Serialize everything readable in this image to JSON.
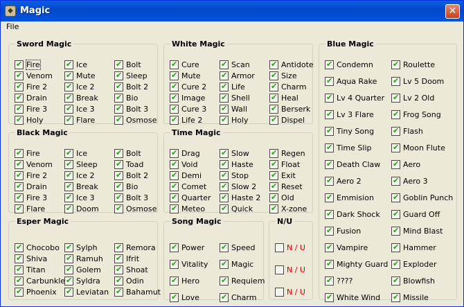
{
  "window": {
    "title": "Magic",
    "icon": "magic-app-icon",
    "close_label": "✕"
  },
  "menu": {
    "file": "File"
  },
  "groups": {
    "sword": {
      "title": "Sword Magic",
      "rows": [
        [
          "Fire",
          "Ice",
          "Bolt"
        ],
        [
          "Venom",
          "Mute",
          "Sleep"
        ],
        [
          "Fire 2",
          "Ice 2",
          "Bolt 2"
        ],
        [
          "Drain",
          "Break",
          "Bio"
        ],
        [
          "Fire 3",
          "Ice 3",
          "Bolt 3"
        ],
        [
          "Holy",
          "Flare",
          "Osmose"
        ]
      ]
    },
    "white": {
      "title": "White Magic",
      "rows": [
        [
          "Cure",
          "Scan",
          "Antidote"
        ],
        [
          "Mute",
          "Armor",
          "Size"
        ],
        [
          "Cure 2",
          "Life",
          "Charm"
        ],
        [
          "Image",
          "Shell",
          "Heal"
        ],
        [
          "Cure 3",
          "Wall",
          "Berserk"
        ],
        [
          "Life 2",
          "Holy",
          "Dispel"
        ]
      ]
    },
    "black": {
      "title": "Black Magic",
      "rows": [
        [
          "Fire",
          "Ice",
          "Bolt"
        ],
        [
          "Venom",
          "Sleep",
          "Toad"
        ],
        [
          "Fire 2",
          "Ice 2",
          "Bolt 2"
        ],
        [
          "Drain",
          "Break",
          "Bio"
        ],
        [
          "Fire 3",
          "Ice 3",
          "Bolt 3"
        ],
        [
          "Flare",
          "Doom",
          "Osmose"
        ]
      ]
    },
    "time": {
      "title": "Time Magic",
      "rows": [
        [
          "Drag",
          "Slow",
          "Regen"
        ],
        [
          "Void",
          "Haste",
          "Float"
        ],
        [
          "Demi",
          "Stop",
          "Exit"
        ],
        [
          "Comet",
          "Slow 2",
          "Reset"
        ],
        [
          "Quarter",
          "Haste 2",
          "Old"
        ],
        [
          "Meteo",
          "Quick",
          "X-zone"
        ]
      ]
    },
    "esper": {
      "title": "Esper Magic",
      "rows": [
        [
          "Chocobo",
          "Sylph",
          "Remora"
        ],
        [
          "Shiva",
          "Ramuh",
          "Ifrit"
        ],
        [
          "Titan",
          "Golem",
          "Shoat"
        ],
        [
          "Carbunkle",
          "Syldra",
          "Odin"
        ],
        [
          "Phoenix",
          "Leviatan",
          "Bahamut"
        ]
      ]
    },
    "song": {
      "title": "Song Magic",
      "rows": [
        [
          "Power",
          "Speed"
        ],
        [
          "Vitality",
          "Magic"
        ],
        [
          "Hero",
          "Requiem"
        ],
        [
          "Love",
          "Charm"
        ]
      ]
    },
    "nu": {
      "title": "N/U",
      "items": [
        "N / U",
        "N / U",
        "N / U"
      ]
    },
    "blue": {
      "title": "Blue Magic",
      "rows": [
        [
          "Condemn",
          "Roulette"
        ],
        [
          "Aqua Rake",
          "Lv 5 Doom"
        ],
        [
          "Lv 4 Quarter",
          "Lv 2 Old"
        ],
        [
          "Lv 3 Flare",
          "Frog Song"
        ],
        [
          "Tiny Song",
          "Flash"
        ],
        [
          "Time Slip",
          "Moon Flute"
        ],
        [
          "Death Claw",
          "Aero"
        ],
        [
          "Aero 2",
          "Aero 3"
        ],
        [
          "Emmision",
          "Goblin Punch"
        ],
        [
          "Dark Shock",
          "Guard Off"
        ],
        [
          "Fusion",
          "Mind Blast"
        ],
        [
          "Vampire",
          "Hammer"
        ],
        [
          "Mighty Guard",
          "Exploder"
        ],
        [
          "????",
          "Blowfish"
        ],
        [
          "White Wind",
          "Missile"
        ]
      ]
    }
  }
}
